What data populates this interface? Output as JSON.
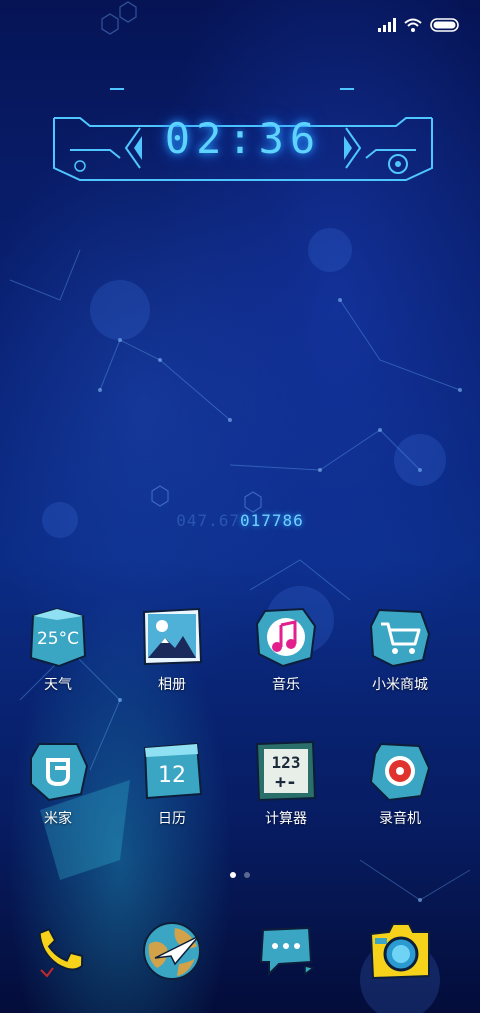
{
  "status_bar": {
    "signal_icon": "signal-bars-icon",
    "wifi_icon": "wifi-icon",
    "battery_icon": "battery-icon"
  },
  "clock_widget": {
    "time": "02:36"
  },
  "digital_readout": {
    "dim_part": "047.67",
    "lit_part": "017786"
  },
  "apps_row1": [
    {
      "label": "天气",
      "icon": "weather-icon",
      "temp_text": "25°C"
    },
    {
      "label": "相册",
      "icon": "gallery-icon"
    },
    {
      "label": "音乐",
      "icon": "music-icon"
    },
    {
      "label": "小米商城",
      "icon": "shopping-cart-icon"
    }
  ],
  "apps_row2": [
    {
      "label": "米家",
      "icon": "mi-home-icon"
    },
    {
      "label": "日历",
      "icon": "calendar-icon",
      "date_text": "12"
    },
    {
      "label": "计算器",
      "icon": "calculator-icon",
      "keys_top": "123",
      "keys_bottom": "+-"
    },
    {
      "label": "录音机",
      "icon": "recorder-icon"
    }
  ],
  "pager": {
    "pages": 2,
    "active": 1
  },
  "dock": [
    {
      "icon": "phone-icon"
    },
    {
      "icon": "browser-icon"
    },
    {
      "icon": "messages-icon"
    },
    {
      "icon": "camera-icon"
    }
  ],
  "colors": {
    "accent": "#5fd3ff",
    "teal_icon": "#35a8c8",
    "background": "#0a2377"
  }
}
